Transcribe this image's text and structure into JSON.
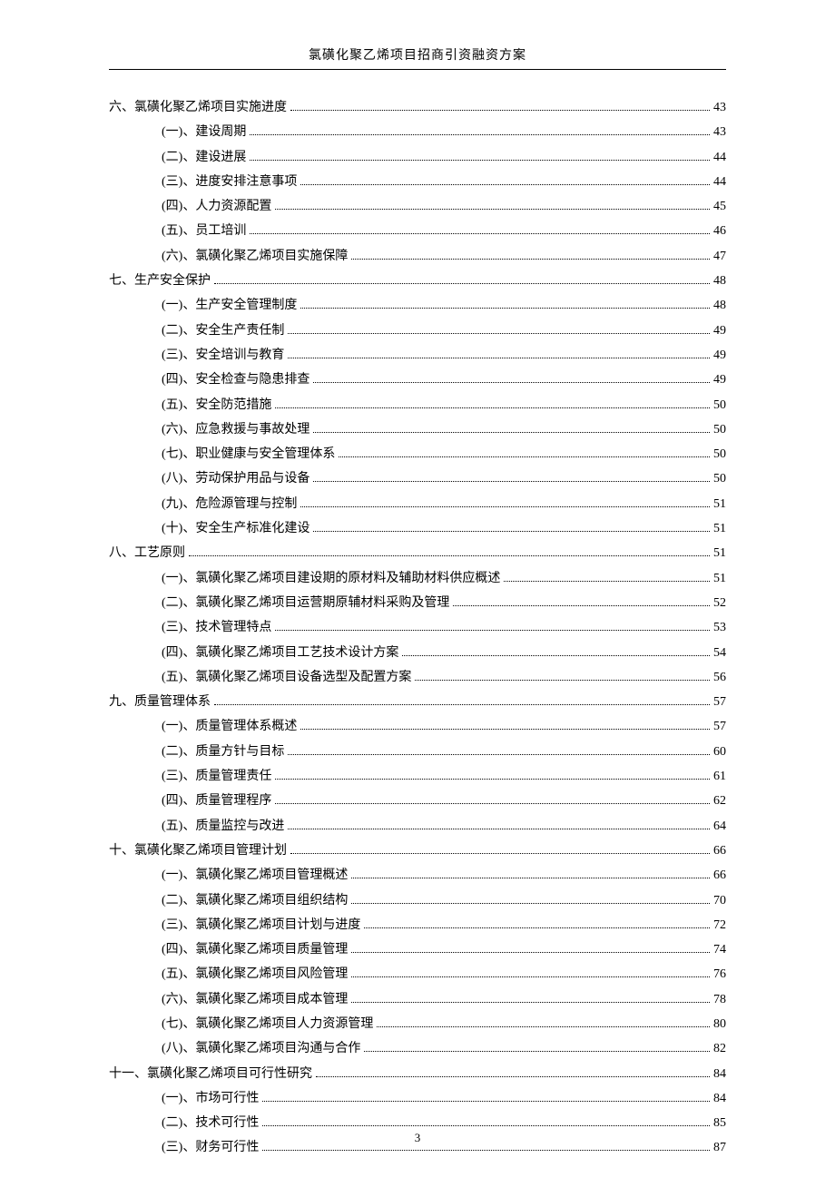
{
  "header": "氯磺化聚乙烯项目招商引资融资方案",
  "pageNumber": "3",
  "toc": [
    {
      "level": 1,
      "label": "六、氯磺化聚乙烯项目实施进度",
      "page": "43"
    },
    {
      "level": 2,
      "label": "(一)、建设周期",
      "page": "43"
    },
    {
      "level": 2,
      "label": "(二)、建设进展",
      "page": "44"
    },
    {
      "level": 2,
      "label": "(三)、进度安排注意事项",
      "page": "44"
    },
    {
      "level": 2,
      "label": "(四)、人力资源配置",
      "page": "45"
    },
    {
      "level": 2,
      "label": "(五)、员工培训",
      "page": "46"
    },
    {
      "level": 2,
      "label": "(六)、氯磺化聚乙烯项目实施保障",
      "page": "47"
    },
    {
      "level": 1,
      "label": "七、生产安全保护",
      "page": "48"
    },
    {
      "level": 2,
      "label": "(一)、生产安全管理制度",
      "page": "48"
    },
    {
      "level": 2,
      "label": "(二)、安全生产责任制",
      "page": "49"
    },
    {
      "level": 2,
      "label": "(三)、安全培训与教育",
      "page": "49"
    },
    {
      "level": 2,
      "label": "(四)、安全检查与隐患排查",
      "page": "49"
    },
    {
      "level": 2,
      "label": "(五)、安全防范措施",
      "page": "50"
    },
    {
      "level": 2,
      "label": "(六)、应急救援与事故处理",
      "page": "50"
    },
    {
      "level": 2,
      "label": "(七)、职业健康与安全管理体系",
      "page": "50"
    },
    {
      "level": 2,
      "label": "(八)、劳动保护用品与设备",
      "page": "50"
    },
    {
      "level": 2,
      "label": "(九)、危险源管理与控制",
      "page": "51"
    },
    {
      "level": 2,
      "label": "(十)、安全生产标准化建设",
      "page": "51"
    },
    {
      "level": 1,
      "label": "八、工艺原则",
      "page": "51"
    },
    {
      "level": 2,
      "label": "(一)、氯磺化聚乙烯项目建设期的原材料及辅助材料供应概述",
      "page": "51"
    },
    {
      "level": 2,
      "label": "(二)、氯磺化聚乙烯项目运营期原辅材料采购及管理",
      "page": "52"
    },
    {
      "level": 2,
      "label": "(三)、技术管理特点",
      "page": "53"
    },
    {
      "level": 2,
      "label": "(四)、氯磺化聚乙烯项目工艺技术设计方案",
      "page": "54"
    },
    {
      "level": 2,
      "label": "(五)、氯磺化聚乙烯项目设备选型及配置方案",
      "page": "56"
    },
    {
      "level": 1,
      "label": "九、质量管理体系",
      "page": "57"
    },
    {
      "level": 2,
      "label": "(一)、质量管理体系概述",
      "page": "57"
    },
    {
      "level": 2,
      "label": "(二)、质量方针与目标",
      "page": "60"
    },
    {
      "level": 2,
      "label": "(三)、质量管理责任",
      "page": "61"
    },
    {
      "level": 2,
      "label": "(四)、质量管理程序",
      "page": "62"
    },
    {
      "level": 2,
      "label": "(五)、质量监控与改进",
      "page": "64"
    },
    {
      "level": 1,
      "label": "十、氯磺化聚乙烯项目管理计划",
      "page": "66"
    },
    {
      "level": 2,
      "label": "(一)、氯磺化聚乙烯项目管理概述",
      "page": "66"
    },
    {
      "level": 2,
      "label": "(二)、氯磺化聚乙烯项目组织结构",
      "page": "70"
    },
    {
      "level": 2,
      "label": "(三)、氯磺化聚乙烯项目计划与进度",
      "page": "72"
    },
    {
      "level": 2,
      "label": "(四)、氯磺化聚乙烯项目质量管理",
      "page": "74"
    },
    {
      "level": 2,
      "label": "(五)、氯磺化聚乙烯项目风险管理",
      "page": "76"
    },
    {
      "level": 2,
      "label": "(六)、氯磺化聚乙烯项目成本管理",
      "page": "78"
    },
    {
      "level": 2,
      "label": "(七)、氯磺化聚乙烯项目人力资源管理",
      "page": "80"
    },
    {
      "level": 2,
      "label": "(八)、氯磺化聚乙烯项目沟通与合作",
      "page": "82"
    },
    {
      "level": 1,
      "label": "十一、氯磺化聚乙烯项目可行性研究",
      "page": "84"
    },
    {
      "level": 2,
      "label": "(一)、市场可行性",
      "page": "84"
    },
    {
      "level": 2,
      "label": "(二)、技术可行性",
      "page": "85"
    },
    {
      "level": 2,
      "label": "(三)、财务可行性",
      "page": "87"
    }
  ]
}
